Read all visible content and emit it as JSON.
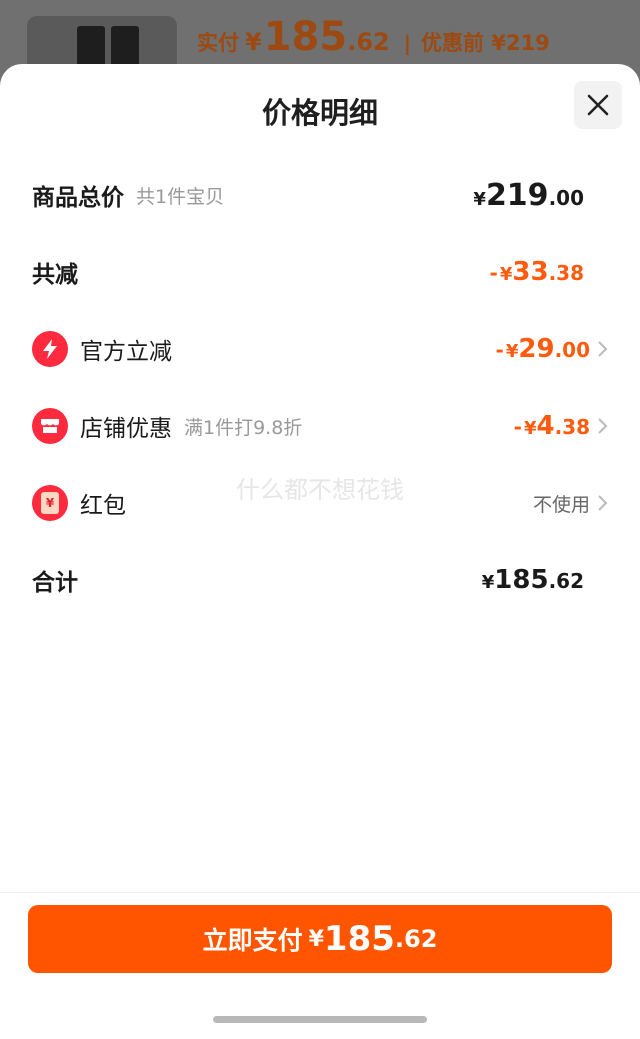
{
  "background": {
    "actual_pay_label": "实付",
    "actual_pay_currency": "¥",
    "actual_pay_int": "185",
    "actual_pay_dec": ".62",
    "separator": "|",
    "before_discount": "优惠前 ¥219"
  },
  "sheet": {
    "title": "价格明细"
  },
  "rows": {
    "goods_total": {
      "label": "商品总价",
      "sub": "共1件宝贝",
      "currency": "¥",
      "int": "219",
      "dec": ".00"
    },
    "total_reduction": {
      "label": "共减",
      "sign": "-",
      "currency": "¥",
      "int": "33",
      "dec": ".38"
    },
    "official_discount": {
      "label": "官方立减",
      "sign": "-",
      "currency": "¥",
      "int": "29",
      "dec": ".00"
    },
    "store_discount": {
      "label": "店铺优惠",
      "sub": "满1件打9.8折",
      "sign": "-",
      "currency": "¥",
      "int": "4",
      "dec": ".38"
    },
    "red_packet": {
      "label": "红包",
      "value": "不使用",
      "icon_glyph": "¥"
    },
    "total": {
      "label": "合计",
      "currency": "¥",
      "int": "185",
      "dec": ".62"
    }
  },
  "watermark": "什么都不想花钱",
  "footer": {
    "pay_label": "立即支付",
    "currency": "¥",
    "int": "185",
    "dec": ".62"
  },
  "colors": {
    "accent_orange": "#ff5a0d",
    "pay_button": "#ff5500",
    "icon_red": "#ff2a3d"
  }
}
